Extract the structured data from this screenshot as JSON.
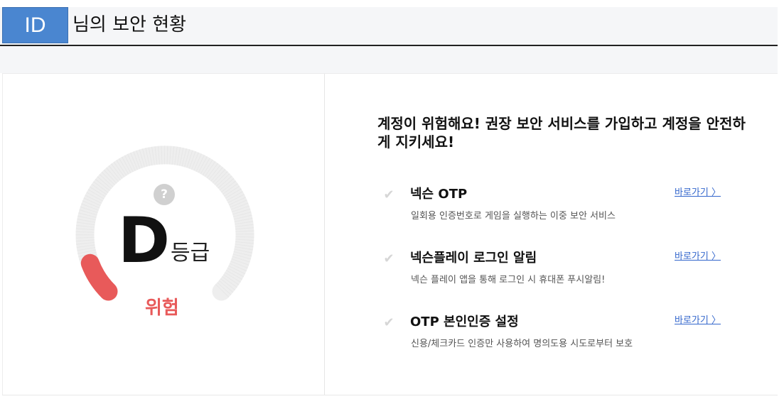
{
  "header": {
    "id_label": "ID",
    "title": "님의 보안 현황"
  },
  "grade": {
    "letter": "D",
    "suffix": "등급",
    "status": "위험",
    "help": "?",
    "level": 1,
    "level_max": 4
  },
  "headline": "계정이 위험해요! 권장 보안 서비스를 가입하고 계정을 안전하게 지키세요!",
  "services": [
    {
      "name": "넥슨 OTP",
      "desc": "일회용 인증번호로 게임을 실행하는 이중 보안 서비스",
      "link": "바로가기 〉"
    },
    {
      "name": "넥슨플레이 로그인 알림",
      "desc": "넥슨 플레이 앱을 통해 로그인 시 휴대폰 푸시알림!",
      "link": "바로가기 〉"
    },
    {
      "name": "OTP 본인인증 설정",
      "desc": "신용/체크카드 인증만 사용하여 명의도용 시도로부터 보호",
      "link": "바로가기 〉"
    }
  ],
  "colors": {
    "danger": "#e85a5a",
    "link": "#3366cc",
    "id_box": "#4a86d0",
    "gauge_track": "#eeeeee"
  },
  "icons": {
    "help": "question-circle-icon",
    "check": "check-icon"
  }
}
